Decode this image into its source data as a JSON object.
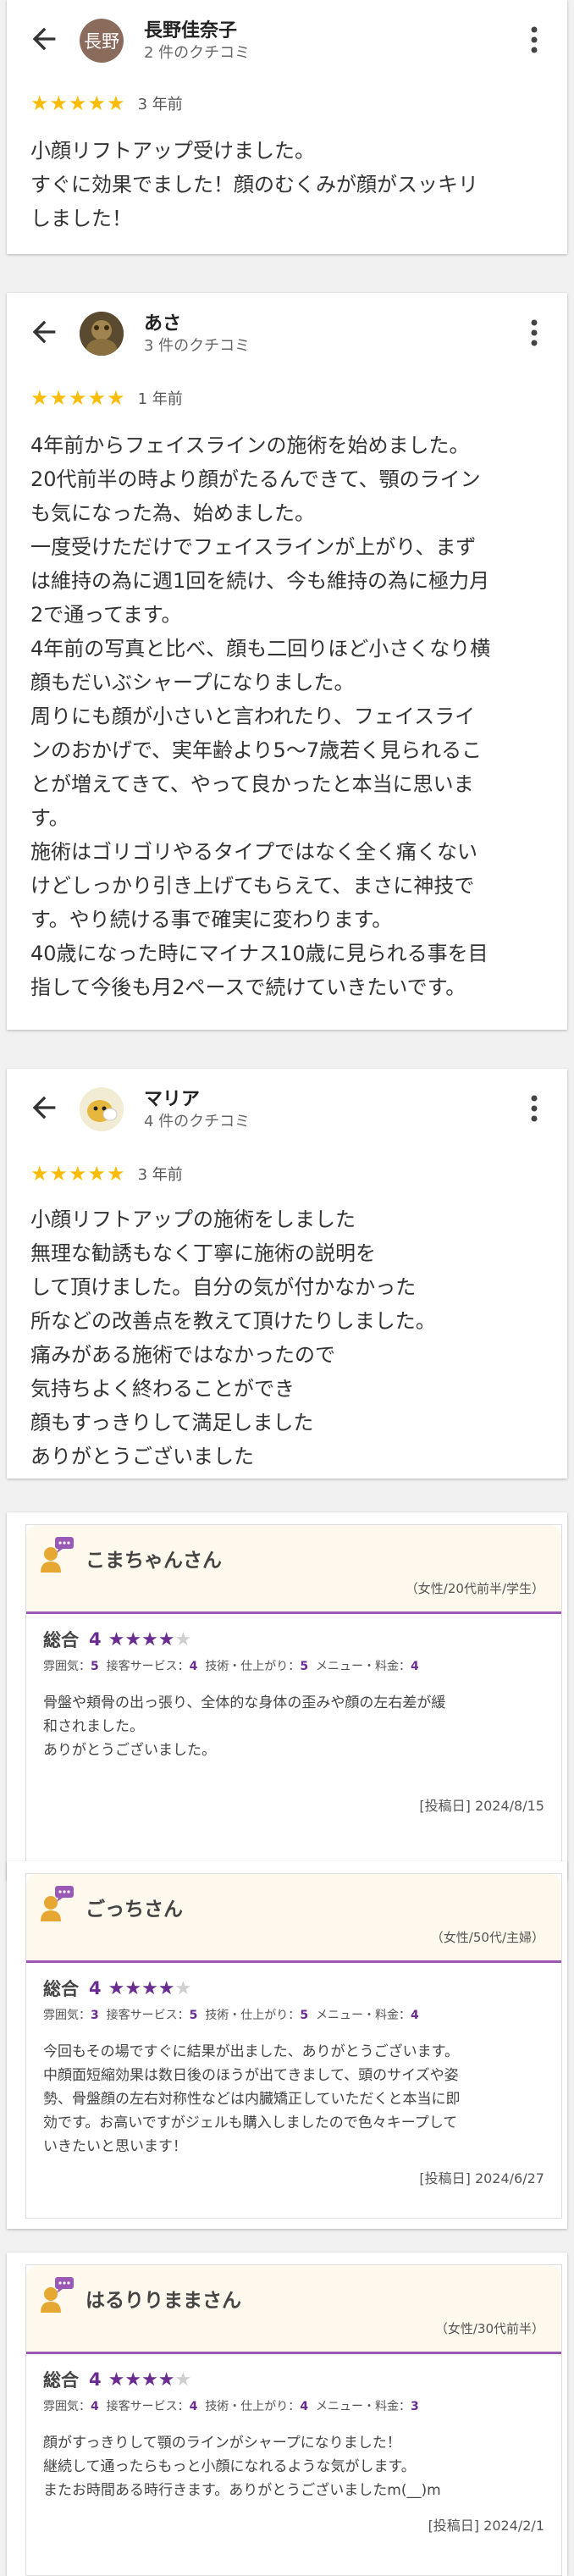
{
  "google_reviews": [
    {
      "name": "長野佳奈子",
      "avatar_text": "長野",
      "avatar_color": "#8b6b5c",
      "count": "2 件のクチコミ",
      "stars": "★★★★★",
      "ago": "3 年前",
      "lines": [
        "小顔リフトアップ受けました。",
        "すぐに効果でました！顔のむくみが顔がスッキリ",
        "しました！"
      ]
    },
    {
      "name": "あさ",
      "avatar_text": "",
      "avatar_color": "#6b5a3a",
      "count": "3 件のクチコミ",
      "stars": "★★★★★",
      "ago": "1 年前",
      "lines": [
        "4年前からフェイスラインの施術を始めました。",
        "20代前半の時より顔がたるんできて、顎のライン",
        "も気になった為、始めました。",
        "一度受けただけでフェイスラインが上がり、まず",
        "は維持の為に週1回を続け、今も維持の為に極力月",
        "2で通ってます。",
        "4年前の写真と比べ、顔も二回りほど小さくなり横",
        "顔もだいぶシャープになりました。",
        "周りにも顔が小さいと言われたり、フェイスライ",
        "ンのおかげで、実年齢より5〜7歳若く見られるこ",
        "とが増えてきて、やって良かったと本当に思いま",
        "す。",
        "施術はゴリゴリやるタイプではなく全く痛くない",
        "けどしっかり引き上げてもらえて、まさに神技で",
        "す。やり続ける事で確実に変わります。",
        "40歳になった時にマイナス10歳に見られる事を目",
        "指して今後も月2ペースで続けていきたいです。"
      ]
    },
    {
      "name": "マリア",
      "avatar_text": "",
      "avatar_color": "#e8d8a0",
      "count": "4 件のクチコミ",
      "stars": "★★★★★",
      "ago": "3 年前",
      "lines": [
        "小顔リフトアップの施術をしました",
        "無理な勧誘もなく丁寧に施術の説明を",
        "して頂けました。自分の気が付かなかった",
        "所などの改善点を教えて頂けたりしました。",
        "痛みがある施術ではなかったので",
        "気持ちよく終わることができ",
        "顔もすっきりして満足しました",
        "ありがとうございました"
      ]
    }
  ],
  "hp_reviews": [
    {
      "name": "こまちゃんさん",
      "attr": "（女性/20代前半/学生）",
      "total_label": "総合",
      "score": "4",
      "sub": [
        {
          "label": "雰囲気：",
          "value": "5"
        },
        {
          "label": "接客サービス：",
          "value": "4"
        },
        {
          "label": "技術・仕上がり：",
          "value": "5"
        },
        {
          "label": "メニュー・料金：",
          "value": "4"
        }
      ],
      "lines": [
        "骨盤や頬骨の出っ張り、全体的な身体の歪みや顔の左右差が緩",
        "和されました。",
        "ありがとうございました。"
      ],
      "date": "[投稿日] 2024/8/15"
    },
    {
      "name": "ごっちさん",
      "attr": "（女性/50代/主婦）",
      "total_label": "総合",
      "score": "4",
      "sub": [
        {
          "label": "雰囲気：",
          "value": "3"
        },
        {
          "label": "接客サービス：",
          "value": "5"
        },
        {
          "label": "技術・仕上がり：",
          "value": "5"
        },
        {
          "label": "メニュー・料金：",
          "value": "4"
        }
      ],
      "lines": [
        "今回もその場ですぐに結果が出ました、ありがとうございます。",
        "中顔面短縮効果は数日後のほうが出てきまして、頭のサイズや姿",
        "勢、骨盤顔の左右対称性などは内臓矯正していただくと本当に即",
        "効です。お高いですがジェルも購入しましたので色々キープして",
        "いきたいと思います！"
      ],
      "date": "[投稿日] 2024/6/27"
    },
    {
      "name": "はるりりままさん",
      "attr": "（女性/30代前半）",
      "total_label": "総合",
      "score": "4",
      "sub": [
        {
          "label": "雰囲気：",
          "value": "4"
        },
        {
          "label": "接客サービス：",
          "value": "4"
        },
        {
          "label": "技術・仕上がり：",
          "value": "4"
        },
        {
          "label": "メニュー・料金：",
          "value": "3"
        }
      ],
      "lines": [
        "顔がすっきりして顎のラインがシャープになりました！",
        "継続して通ったらもっと小顔になれるような気がします。",
        "またお時間ある時行きます。ありがとうございましたm(__)m"
      ],
      "date": "[投稿日] 2024/2/1"
    }
  ]
}
